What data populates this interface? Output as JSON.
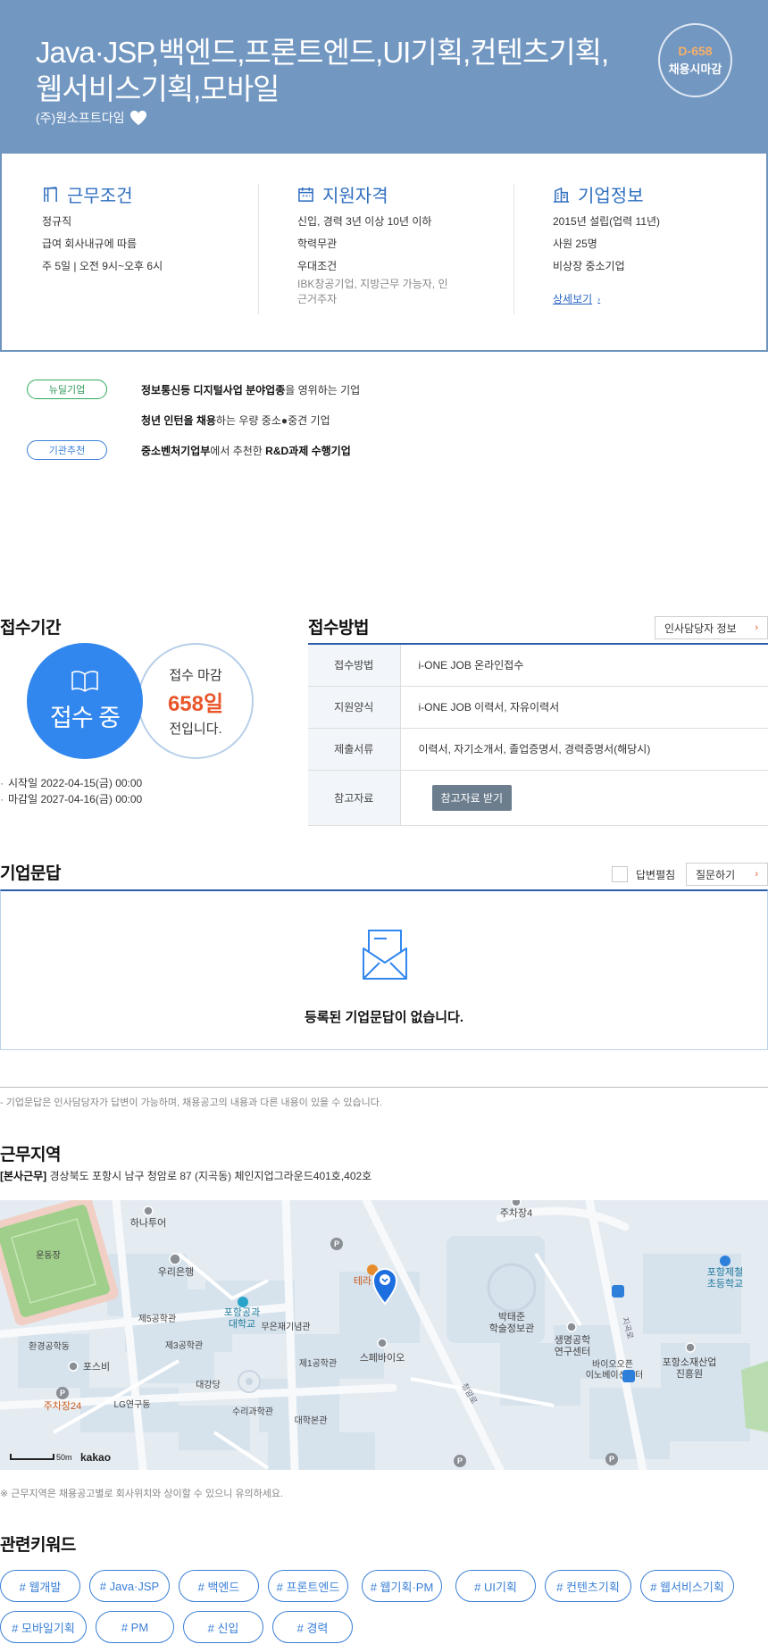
{
  "header": {
    "title_line1": "Java·JSP,백엔드,프론트엔드,UI기획,컨텐츠기획,",
    "title_line2": "웹서비스기획,모바일",
    "company": "(주)원소프트다임",
    "dday": "D-658",
    "deadline_type": "채용시마감"
  },
  "work_conditions": {
    "title": "근무조건",
    "items": [
      "정규직",
      "급여 회사내규에 따름",
      "주 5일 | 오전 9시~오후 6시"
    ]
  },
  "qualifications": {
    "title": "지원자격",
    "items": [
      "신입, 경력 3년 이상 10년 이하",
      "학력무관",
      "우대조건"
    ],
    "preferred_detail": "IBK창공기업, 지방근무 가능자, 인근거주자"
  },
  "company_info": {
    "title": "기업정보",
    "items": [
      "2015년 설립(업력 11년)",
      "사원 25명",
      "비상장 중소기업"
    ],
    "detail_link": "상세보기"
  },
  "badges": [
    {
      "label": "뉴딜기업",
      "pre": "",
      "strong": "정보통신등 디지털사업 분야업종",
      "post": "을 영위하는 기업"
    },
    {
      "label": "",
      "pre": "",
      "strong": "청년 인턴을 채용",
      "post": "하는 우량 중소●중견 기업"
    },
    {
      "label": "기관추천",
      "pre": "",
      "strong": "중소벤처기업부",
      "post": "에서 추천한 ",
      "strong2": "R&D과제 수행기업"
    }
  ],
  "period": {
    "title": "접수기간",
    "status": "접수 중",
    "side_line1": "접수 마감",
    "days_left": "658일",
    "side_line3": "전입니다.",
    "start": "시작일 2022-04-15(금) 00:00",
    "end": "마감일 2027-04-16(금) 00:00"
  },
  "method": {
    "title": "접수방법",
    "hr_button": "인사담당자 정보",
    "rows": [
      {
        "label": "접수방법",
        "value": "i-ONE JOB 온라인접수"
      },
      {
        "label": "지원양식",
        "value": "i-ONE JOB 이력서, 자유이력서"
      },
      {
        "label": "제출서류",
        "value": "이력서, 자기소개서, 졸업증명서, 경력증명서(해당시)"
      },
      {
        "label": "참고자료",
        "value": ""
      }
    ],
    "ref_button": "참고자료 받기"
  },
  "qa": {
    "title": "기업문답",
    "toggle_label": "답변펼침",
    "ask_button": "질문하기",
    "empty_message": "등록된 기업문답이 없습니다.",
    "note": "- 기업문답은 인사담당자가 답변이 가능하며, 채용공고의 내용과 다른 내용이 있을 수 있습니다."
  },
  "location": {
    "title": "근무지역",
    "tag": "[본사근무]",
    "address": "경상북도 포항시 남구 청암로 87 (지곡동) 체인지업그라운드401호,402호",
    "map_labels": {
      "hana": "하나투어",
      "woori": "우리은행",
      "field": "운동장",
      "eng5": "제5공학관",
      "eng3": "제3공학관",
      "env": "환경공학동",
      "posbi": "포스비",
      "lg": "LG연구동",
      "pk24": "주차장24",
      "postech1": "포항공과",
      "postech2": "대학교",
      "mueun": "무은재기념관",
      "eng1": "제1공학관",
      "daegang": "대강당",
      "math": "수리과학관",
      "main": "대학본관",
      "spe": "스페바이오",
      "terra": "테라조",
      "library1": "박태준",
      "library2": "학술정보관",
      "pk4": "주차장4",
      "life1": "생명공학",
      "life2": "연구센터",
      "bio1": "바이오오픈",
      "bio2": "이노베이션센터",
      "steel1": "포항제철",
      "steel2": "초등학교",
      "mat1": "포항소재산업",
      "mat2": "진흥원",
      "road1": "청암로",
      "road2": "지곡로",
      "scale": "50m",
      "brand": "kakao"
    },
    "note": "※ 근무지역은 채용공고별로 회사위치와 상이할 수 있으니 유의하세요."
  },
  "keywords": {
    "title": "관련키워드",
    "items": [
      "# 웹개발",
      "# Java·JSP",
      "# 백엔드",
      "# 프론트엔드",
      "# 웹기획·PM",
      "# UI기획",
      "# 컨텐츠기획",
      "# 웹서비스기획",
      "# 모바일기획",
      "# PM",
      "# 신입",
      "# 경력"
    ]
  },
  "colors": {
    "header_bg": "#7297c1",
    "accent_blue": "#3287ee",
    "accent_orange": "#e8562a",
    "nav_navy": "#2b5ea8"
  }
}
